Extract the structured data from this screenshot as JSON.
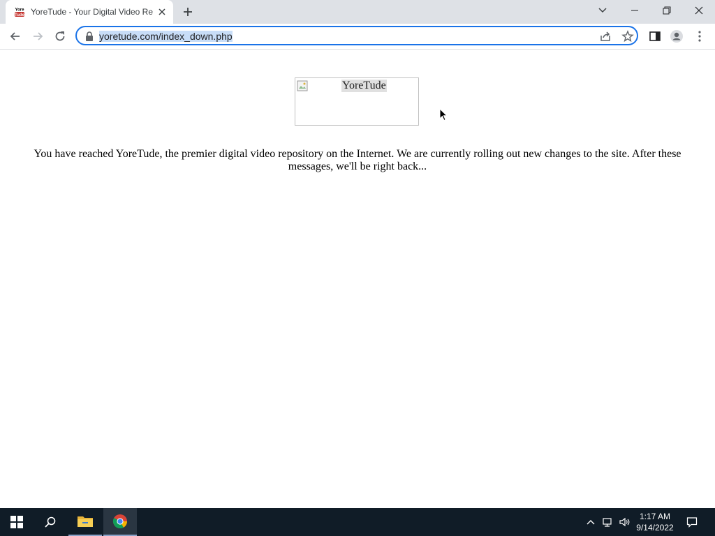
{
  "browser": {
    "tab_title": "YoreTude - Your Digital Video Re",
    "favicon_text": [
      "Yore",
      "Tude"
    ],
    "url": "yoretude.com/index_down.php"
  },
  "page": {
    "logo_alt": "YoreTude",
    "message": "You have reached YoreTude, the premier digital video repository on the Internet. We are currently rolling out new changes to the site. After these messages, we'll be right back..."
  },
  "taskbar": {
    "time": "1:17 AM",
    "date": "9/14/2022"
  },
  "colors": {
    "accent": "#1a73e8",
    "taskbar_bg": "#101c27",
    "tabstrip_bg": "#dee1e6"
  }
}
